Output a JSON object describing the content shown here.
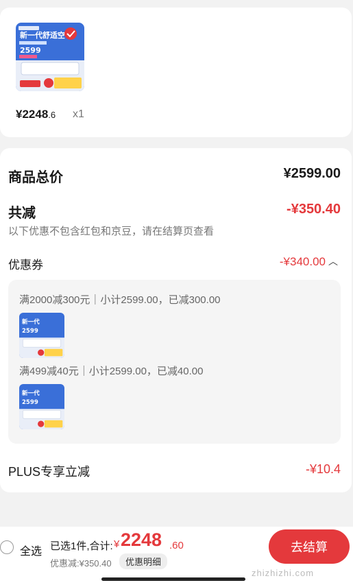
{
  "item": {
    "image_promo_text": "新一代舒适空",
    "image_price": "2599",
    "price_int": "¥2248",
    "price_dec": ".6",
    "qty": "x1"
  },
  "summary": {
    "goods_total_label": "商品总价",
    "goods_total": "¥2599.00",
    "total_discount_label": "共减",
    "total_discount": "-¥350.40",
    "note": "以下优惠不包含红包和京豆，请在结算页查看",
    "coupon_label": "优惠券",
    "coupon_value": "-¥340.00",
    "coupon_rules": [
      {
        "text": "满2000减300元｜小计2599.00，已减300.00"
      },
      {
        "text": "满499减40元｜小计2599.00，已减40.00"
      }
    ],
    "plus_label": "PLUS专享立减",
    "plus_value": "-¥10.4"
  },
  "footer": {
    "select_all": "全选",
    "selected": "已选1件,合计:",
    "currency": "¥",
    "total_int": "2248",
    "total_dec": ".60",
    "saved": "优惠减:¥350.40",
    "detail_button": "优惠明细",
    "checkout_button": "去结算",
    "watermark": "zhizhizhi.com"
  },
  "colors": {
    "accent": "#e4393c",
    "background": "#f2f2f2"
  },
  "icons": [
    "chevron-up-icon",
    "radio-unchecked-icon"
  ]
}
